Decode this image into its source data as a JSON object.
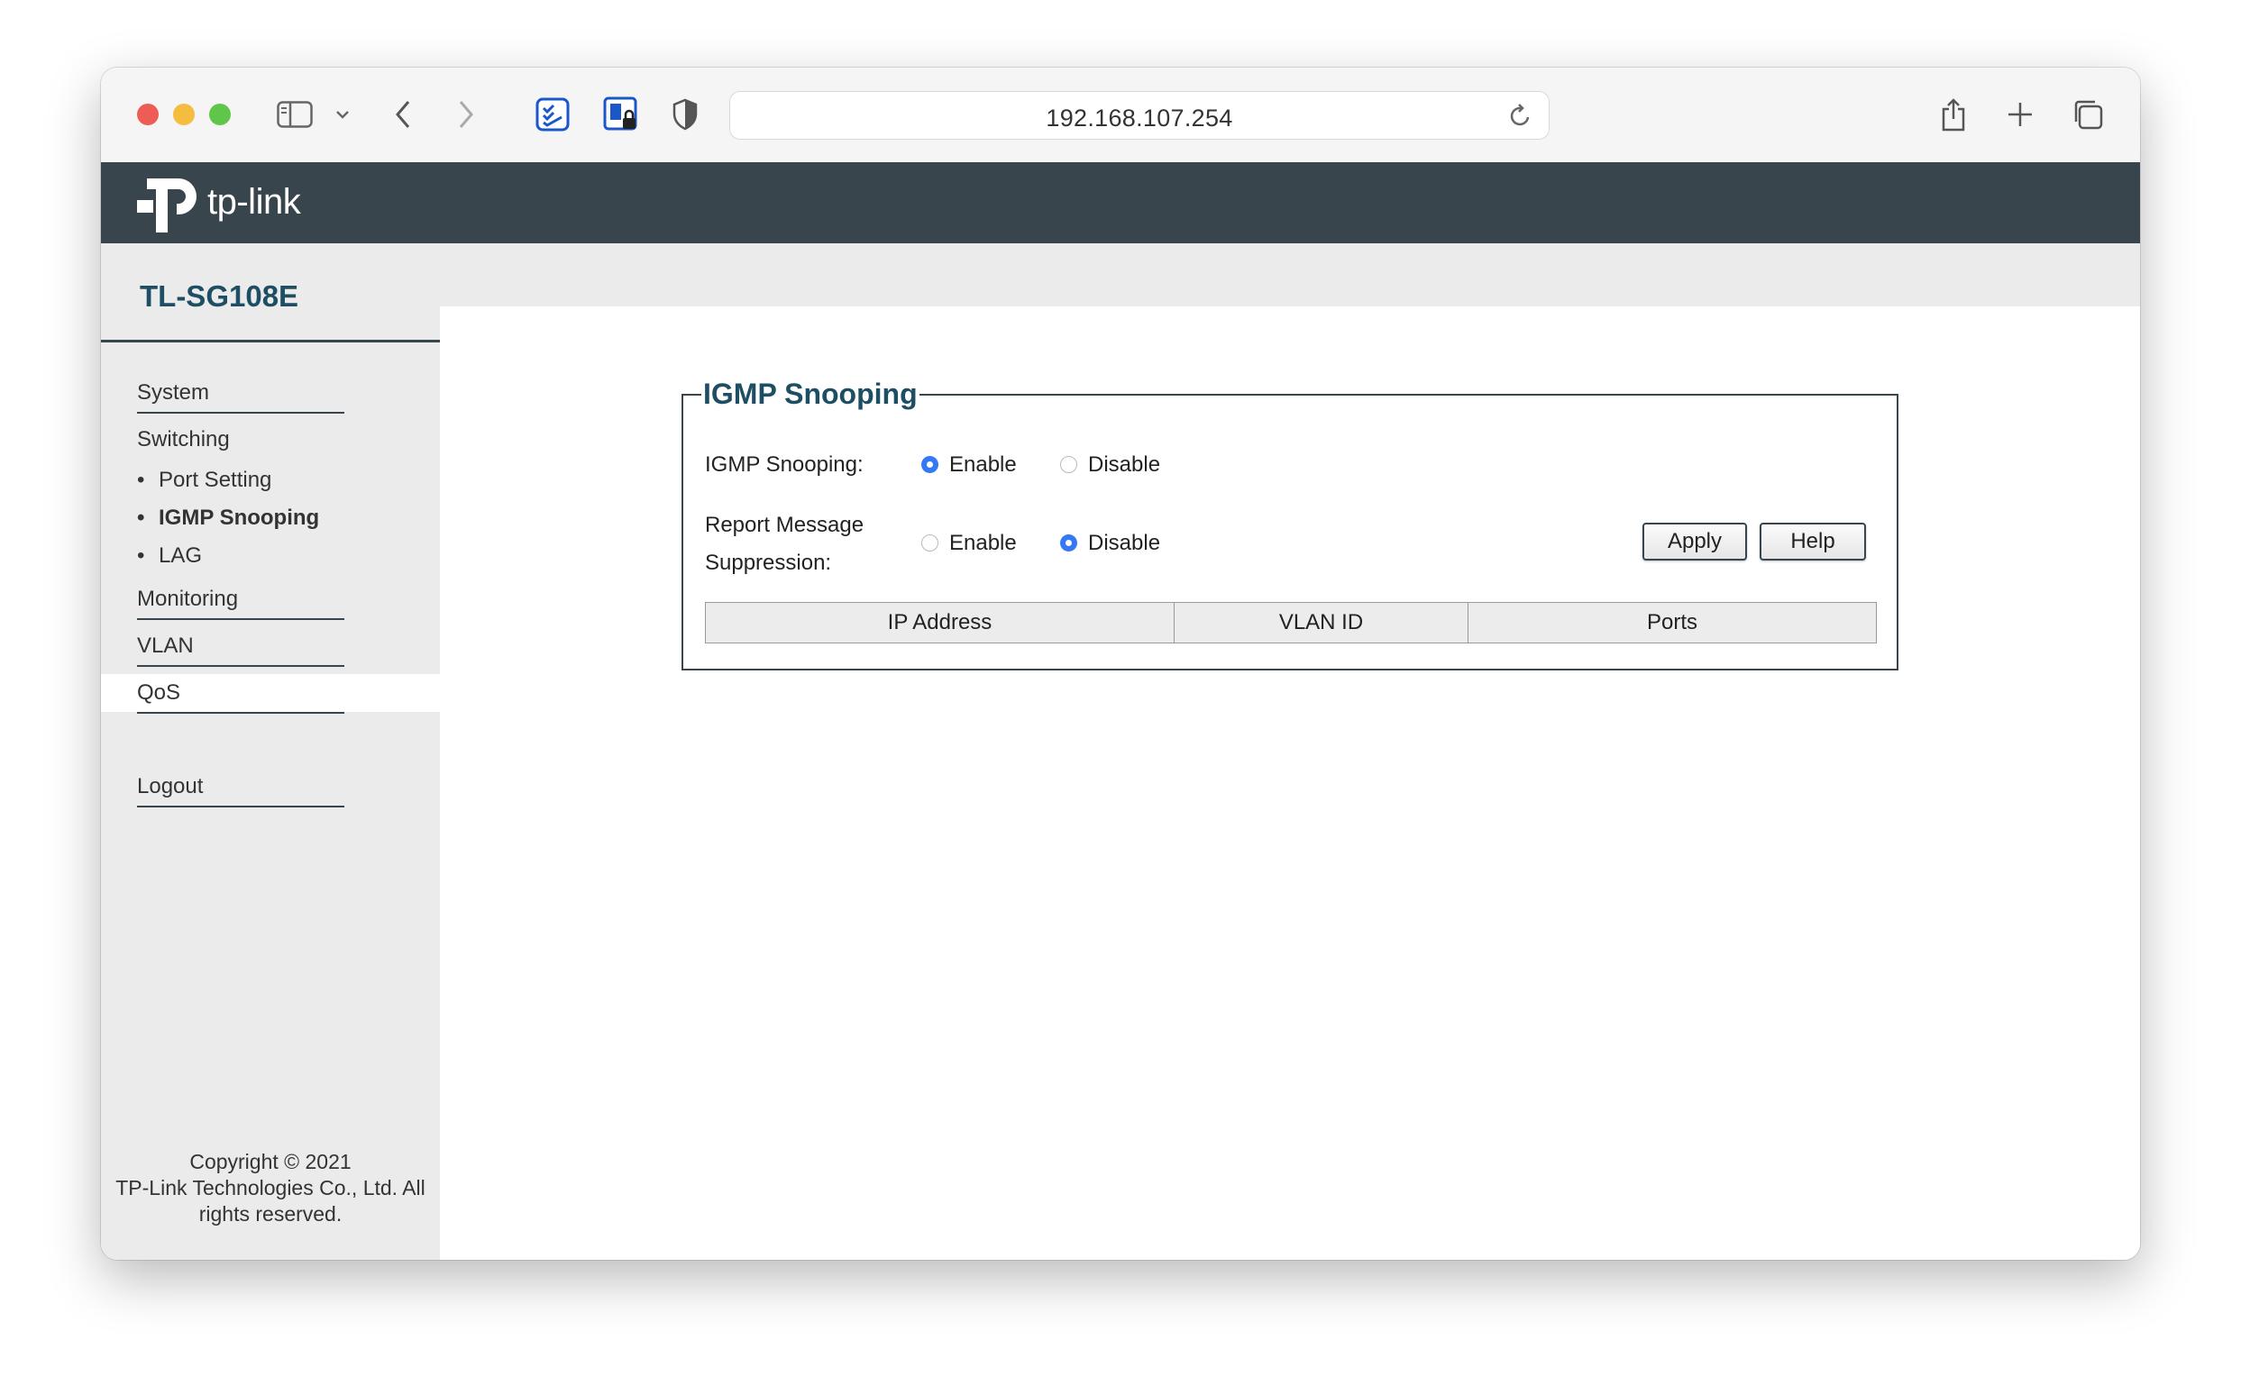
{
  "browser": {
    "url": "192.168.107.254"
  },
  "brand": {
    "logo_text": "tp-link",
    "model": "TL-SG108E"
  },
  "sidebar": {
    "items": [
      {
        "label": "System"
      },
      {
        "label": "Switching"
      },
      {
        "label": "Monitoring"
      },
      {
        "label": "VLAN"
      },
      {
        "label": "QoS"
      },
      {
        "label": "Logout"
      }
    ],
    "switching_sub": [
      {
        "label": "Port Setting",
        "active": false
      },
      {
        "label": "IGMP Snooping",
        "active": true
      },
      {
        "label": "LAG",
        "active": false
      }
    ],
    "copyright": [
      "Copyright © 2021",
      "TP-Link Technologies Co., Ltd. All",
      "rights reserved."
    ]
  },
  "igmp": {
    "legend": "IGMP Snooping",
    "snooping_label": "IGMP Snooping:",
    "snooping_enable": "Enable",
    "snooping_disable": "Disable",
    "snooping_value": "Enable",
    "report_label_1": "Report Message",
    "report_label_2": "Suppression:",
    "report_enable": "Enable",
    "report_disable": "Disable",
    "report_value": "Disable",
    "apply": "Apply",
    "help": "Help",
    "table_headers": [
      "IP Address",
      "VLAN ID",
      "Ports"
    ]
  },
  "colors": {
    "header_bg": "#38454d",
    "accent_text": "#1d4e63",
    "radio_selected": "#3478f6"
  }
}
